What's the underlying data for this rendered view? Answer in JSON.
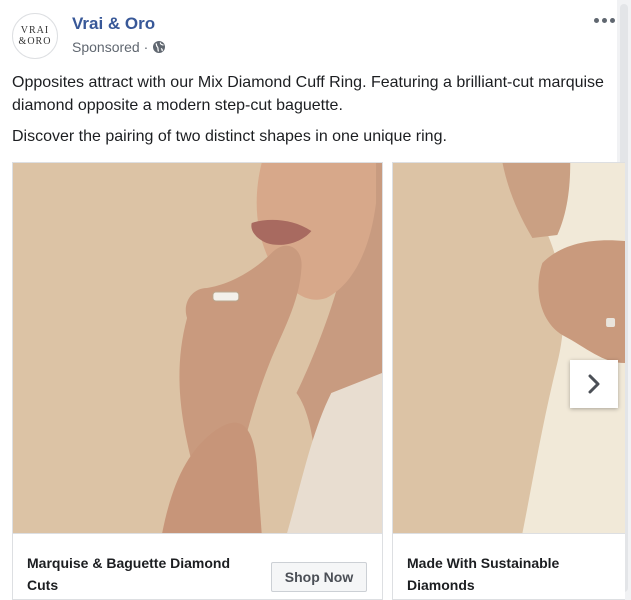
{
  "post": {
    "page_name": "Vrai & Oro",
    "avatar_line1": "VRAI",
    "avatar_line2": "&ORO",
    "sponsored": "Sponsored ·",
    "privacy_icon": "globe-icon",
    "more_icon": "more-options-icon",
    "body_line1": "Opposites attract with our Mix Diamond Cuff Ring. Featuring a brilliant-cut marquise diamond opposite a modern step-cut baguette.",
    "body_line2": "Discover the pairing of two distinct shapes in one unique ring."
  },
  "carousel": {
    "cards": [
      {
        "title": "Marquise & Baguette Diamond Cuts",
        "cta": "Shop Now"
      },
      {
        "title": "Made With Sustainable Diamonds"
      }
    ],
    "next_icon": "chevron-right-icon"
  },
  "colors": {
    "link_blue": "#385898",
    "photo_background": "#dcc3a5",
    "secondary_text": "#606770"
  }
}
